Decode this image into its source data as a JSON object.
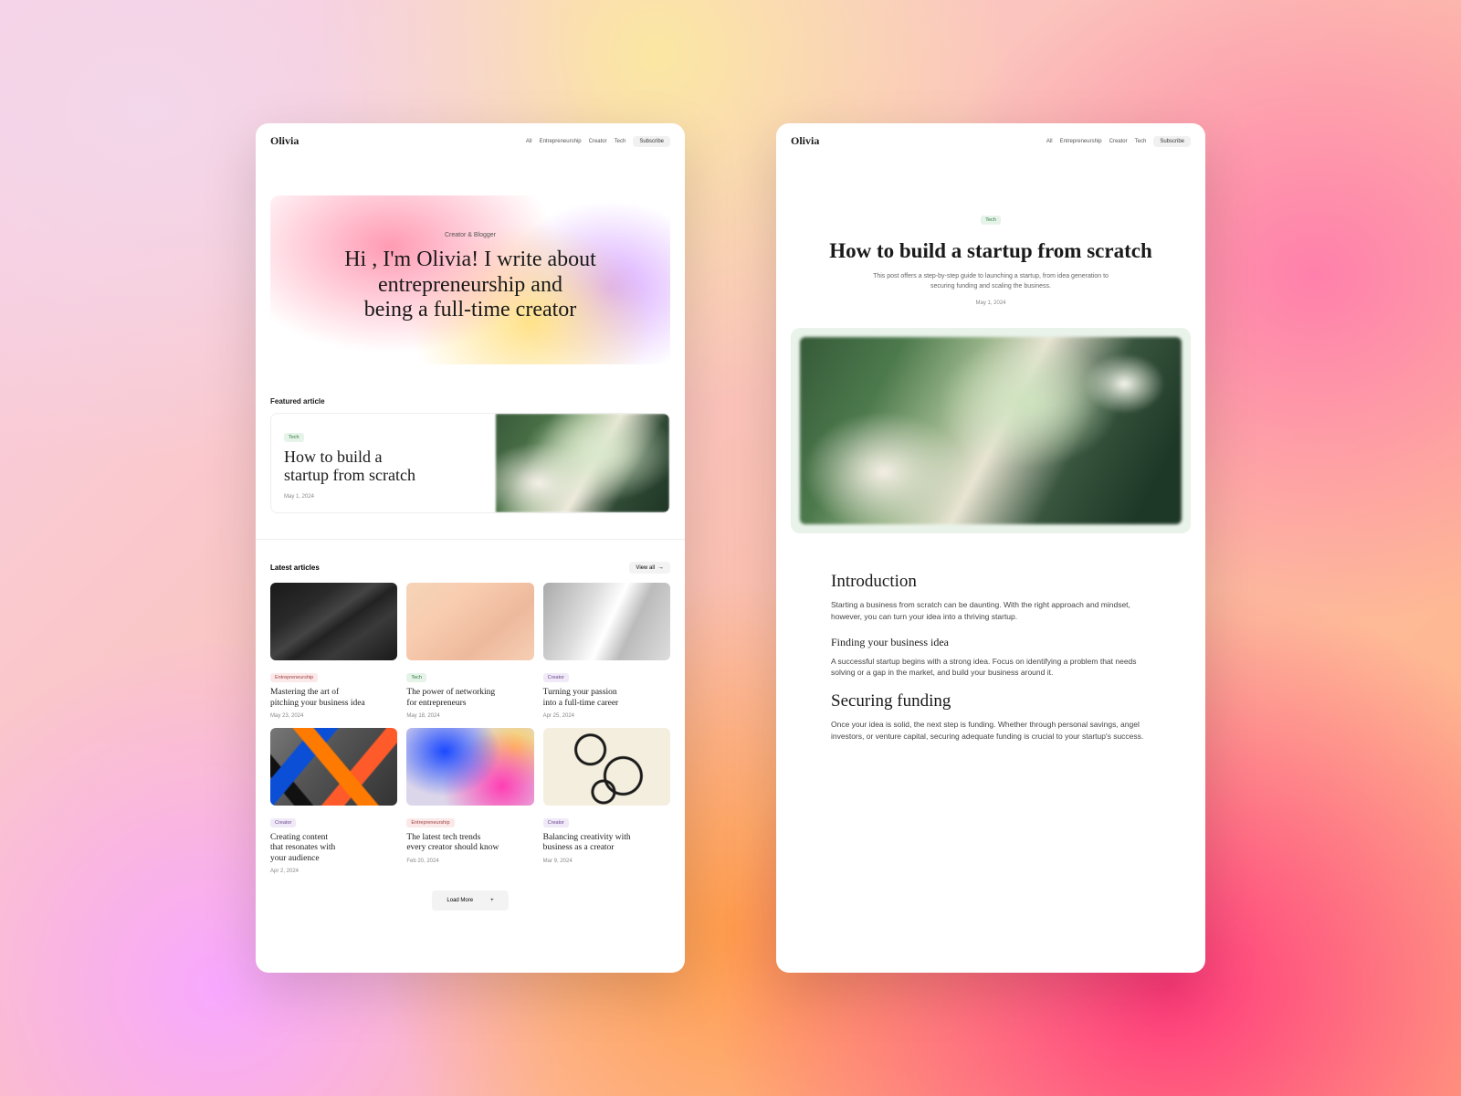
{
  "brand": "Olivia",
  "nav": {
    "all": "All",
    "ent": "Entrepreneurship",
    "creator": "Creator",
    "tech": "Tech",
    "subscribe": "Subscribe"
  },
  "hero": {
    "eyebrow": "Creator & Blogger",
    "line1": "Hi , I'm Olivia! I write about",
    "line2": "entrepreneurship and",
    "line3": "being a full-time creator"
  },
  "featured": {
    "section": "Featured article",
    "tag": "Tech",
    "title_l1": "How to build a",
    "title_l2": "startup from scratch",
    "date": "May 1, 2024"
  },
  "latest": {
    "section": "Latest articles",
    "viewall": "View all",
    "loadmore": "Load More"
  },
  "cards": [
    {
      "tag": "Entrepreneurship",
      "tagcls": "ent",
      "l1": "Mastering the art of",
      "l2": "pitching your business idea",
      "date": "May 23, 2024"
    },
    {
      "tag": "Tech",
      "tagcls": "tech",
      "l1": "The power of networking",
      "l2": "for entrepreneurs",
      "date": "May 18, 2024"
    },
    {
      "tag": "Creator",
      "tagcls": "creator",
      "l1": "Turning your passion",
      "l2": "into a full-time career",
      "date": "Apr 25, 2024"
    },
    {
      "tag": "Creator",
      "tagcls": "creator",
      "l1": "Creating content",
      "l2": "that resonates with",
      "l3": "your audience",
      "date": "Apr 2, 2024"
    },
    {
      "tag": "Entrepreneurship",
      "tagcls": "ent",
      "l1": "The latest tech trends",
      "l2": "every creator should know",
      "date": "Feb 20, 2024"
    },
    {
      "tag": "Creator",
      "tagcls": "creator",
      "l1": "Balancing creativity with",
      "l2": "business as a creator",
      "date": "Mar 9, 2024"
    }
  ],
  "article": {
    "tag": "Tech",
    "title": "How to build a startup from scratch",
    "excerpt": "This post offers a step-by-step guide to launching a startup, from idea generation to securing funding and scaling the business.",
    "date": "May 1, 2024",
    "h_intro": "Introduction",
    "p_intro": "Starting a business from scratch can be daunting. With the right approach and mindset, however, you can turn your idea into a thriving startup.",
    "h_idea": "Finding your business idea",
    "p_idea": "A successful startup begins with a strong idea. Focus on identifying a problem that needs solving or a gap in the market, and build your business around it.",
    "h_fund": "Securing funding",
    "p_fund": "Once your idea is solid, the next step is funding. Whether through personal savings, angel investors, or venture capital, securing adequate funding is crucial to your startup's success."
  }
}
